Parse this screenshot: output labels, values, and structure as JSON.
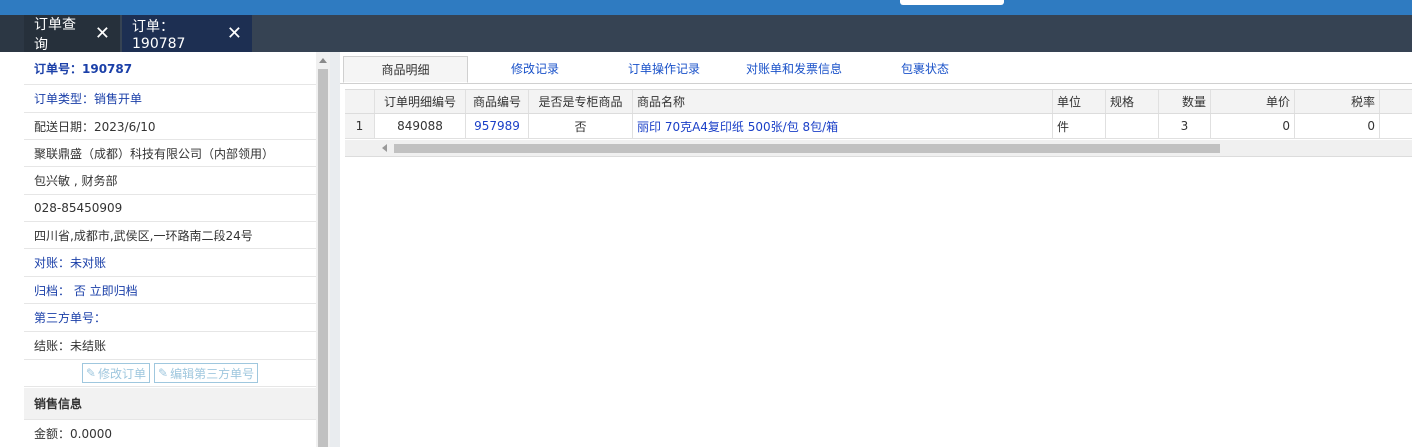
{
  "tabs": [
    {
      "label": "订单查询",
      "close": "✕"
    },
    {
      "label": "订单：190787",
      "close": "✕"
    }
  ],
  "order": {
    "number": "订单号：190787",
    "type": "订单类型：销售开单",
    "delivery_date": "配送日期：2023/6/10",
    "company": "聚联鼎盛（成都）科技有限公司（内部领用）",
    "contact": "包兴敏 , 财务部",
    "phone": "028-85450909",
    "address": "四川省,成都市,武侯区,一环路南二段24号",
    "reconcile": "对账：未对账",
    "archive": "归档：  否 立即归档",
    "third_party": "第三方单号：",
    "settle": "结账：未结账",
    "buttons": {
      "edit_order": "修改订单",
      "edit_third_party": "编辑第三方单号"
    },
    "sales_header": "销售信息",
    "amount": "金额：0.0000"
  },
  "right_tabs": [
    "商品明细",
    "修改记录",
    "订单操作记录",
    "对账单和发票信息",
    "包裹状态"
  ],
  "grid": {
    "columns": [
      "",
      "订单明细编号",
      "商品编号",
      "是否是专柜商品",
      "商品名称",
      "单位",
      "规格",
      "数量",
      "单价",
      "税率"
    ],
    "rows": [
      {
        "index": "1",
        "detail_id": "849088",
        "product_id": "957989",
        "counter": "否",
        "name": "丽印 70克A4复印纸 500张/包 8包/箱",
        "unit": "件",
        "spec": "",
        "qty": "3",
        "price": "0",
        "tax": "0"
      }
    ]
  },
  "colors": {
    "top_bar": "#2f7bc1",
    "tab_strip": "#364353",
    "link": "#1a3fc7"
  },
  "icons": {
    "close": "close-icon",
    "edit": "edit-icon"
  }
}
